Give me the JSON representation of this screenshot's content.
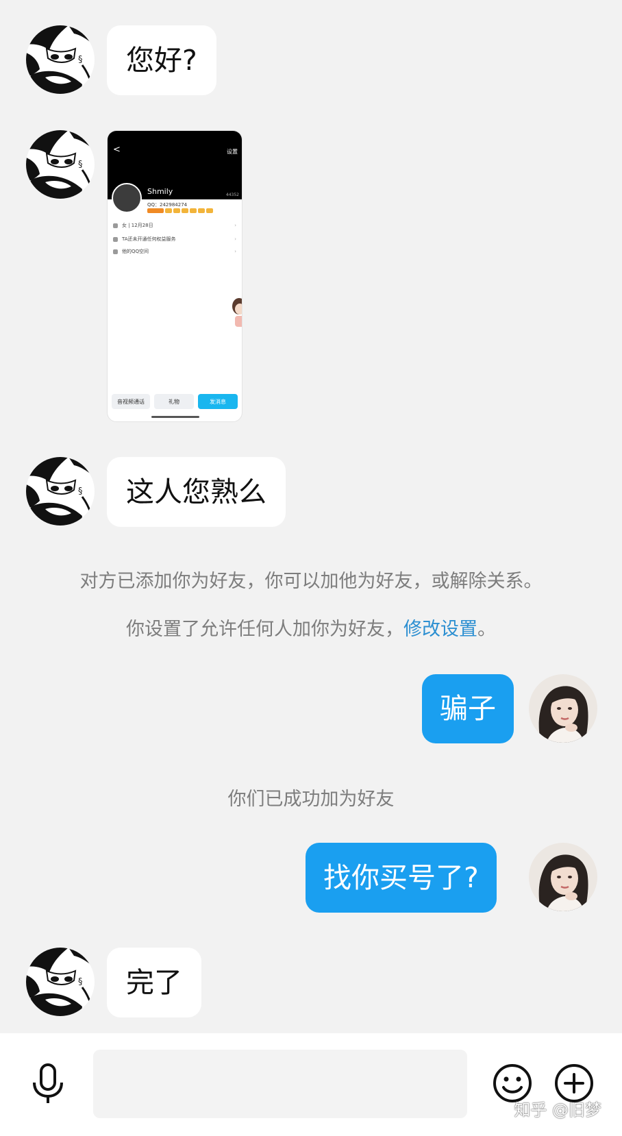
{
  "messages": {
    "m1": "您好?",
    "m3": "这人您熟么",
    "m4": "骗子",
    "m5": "找你买号了?",
    "m6": "完了"
  },
  "system": {
    "line1": "对方已添加你为好友，你可以加他为好友，或解除关系。",
    "line2_text": "你设置了允许任何人加你为好友，",
    "line2_link": "修改设置",
    "line2_end": "。",
    "line3": "你们已成功加为好友"
  },
  "screenshot": {
    "back": "<",
    "settings": "设置",
    "count": "44352",
    "name": "Shmily",
    "qq": "QQ：242984274",
    "rows": [
      "女 | 12月28日",
      "TA还未开通任何权益服务",
      "他的QQ空间"
    ],
    "buttons": [
      "音视频通话",
      "礼物",
      "发消息"
    ]
  },
  "input": {
    "voice_icon": "microphone-icon",
    "emoji_icon": "emoji-icon",
    "plus_icon": "plus-icon"
  },
  "watermark": "知乎 @旧梦",
  "colors": {
    "background": "#f2f2f2",
    "outgoing_bubble": "#1a9ff0",
    "link": "#2c8fd1"
  }
}
